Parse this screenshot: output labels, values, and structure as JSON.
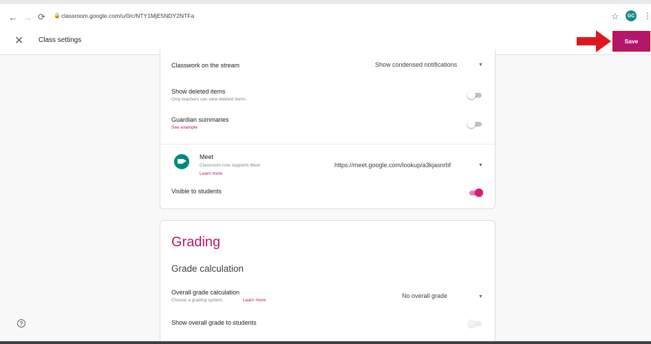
{
  "browser": {
    "url": "classroom.google.com/u/0/c/NTY1MjE5NDY2NTFa",
    "profile_initials": "GC"
  },
  "header": {
    "title": "Class settings",
    "save_label": "Save"
  },
  "general": {
    "classwork_stream": {
      "label": "Classwork on the stream",
      "value": "Show condensed notifications"
    },
    "deleted_items": {
      "label": "Show deleted items",
      "sublabel": "Only teachers can view deleted items.",
      "enabled": false
    },
    "guardian_summaries": {
      "label": "Guardian summaries",
      "link": "See example",
      "enabled": false
    },
    "meet": {
      "label": "Meet",
      "sublabel": "Classroom now supports Meet",
      "link": "Learn more",
      "value": "https://meet.google.com/lookup/a3kjasnrbf"
    },
    "visible_to_students": {
      "label": "Visible to students",
      "enabled": true
    }
  },
  "grading": {
    "title": "Grading",
    "section_title": "Grade calculation",
    "overall_calc": {
      "label": "Overall grade calculation",
      "sublabel": "Choose a grading system.",
      "link": "Learn more",
      "value": "No overall grade"
    },
    "show_overall": {
      "label": "Show overall grade to students",
      "enabled": false
    }
  },
  "colors": {
    "accent": "#b3176d",
    "toggle_on": "#d81b73",
    "meet_icon": "#00897b"
  }
}
